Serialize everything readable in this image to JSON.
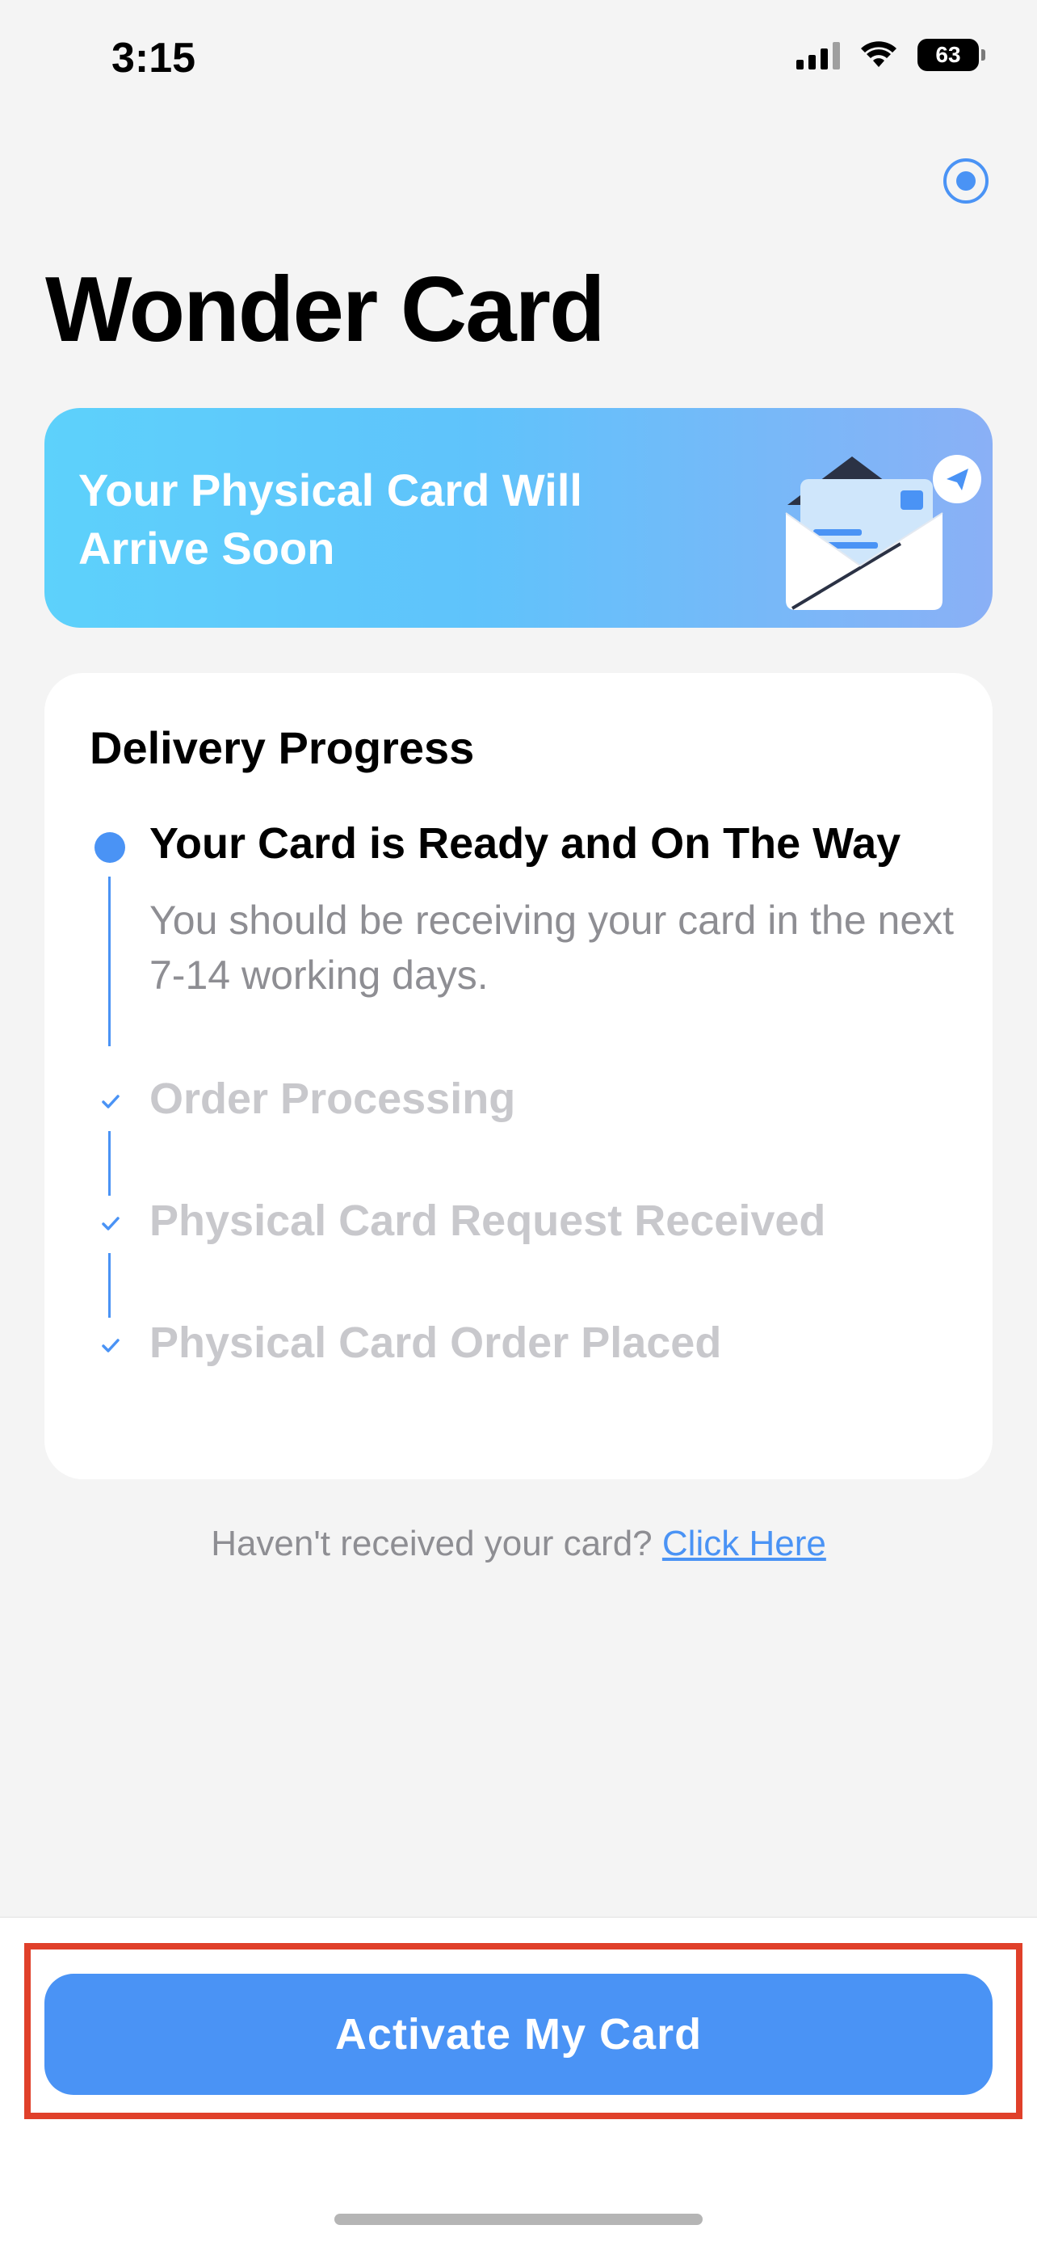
{
  "status_bar": {
    "time": "3:15",
    "battery": "63"
  },
  "page": {
    "title": "Wonder Card"
  },
  "banner": {
    "text": "Your Physical Card Will Arrive Soon"
  },
  "delivery": {
    "heading": "Delivery Progress",
    "current_step": {
      "title": "Your Card is Ready and On The Way",
      "description": "You should be receiving your card in the next 7-14 working days."
    },
    "completed_steps": [
      "Order Processing",
      "Physical Card Request Received",
      "Physical Card Order Placed"
    ]
  },
  "help": {
    "prompt": "Haven't received your card?",
    "link": "Click Here"
  },
  "footer": {
    "activate_label": "Activate My Card"
  },
  "colors": {
    "accent": "#4a93f5",
    "highlight": "#e0402a"
  },
  "icons": [
    "signal-icon",
    "wifi-icon",
    "battery-icon",
    "record-icon",
    "envelope-icon",
    "check-icon"
  ]
}
